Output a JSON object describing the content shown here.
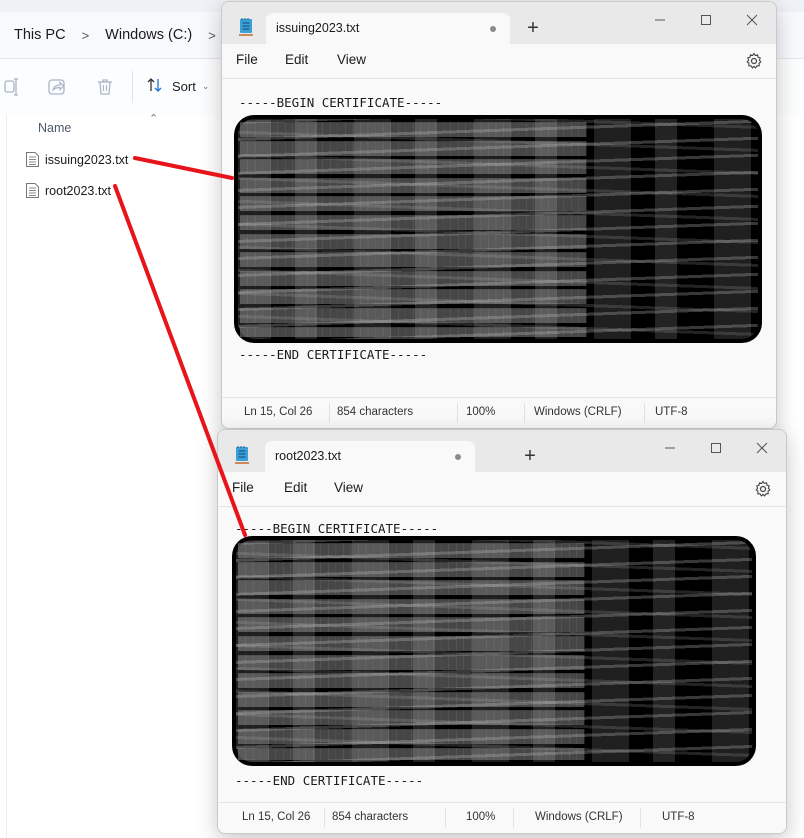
{
  "explorer": {
    "breadcrumb": [
      "This PC",
      "Windows (C:)"
    ],
    "breadcrumb_separator": ">",
    "toolbar": {
      "icons": [
        "rename-icon",
        "share-icon",
        "delete-icon"
      ],
      "sort_label": "Sort"
    },
    "list": {
      "column_header": "Name",
      "files": [
        {
          "name": "issuing2023.txt",
          "icon": "text-file-icon"
        },
        {
          "name": "root2023.txt",
          "icon": "text-file-icon"
        }
      ]
    }
  },
  "notepads": [
    {
      "tab_title": "issuing2023.txt",
      "unsaved_dot": true,
      "menu": [
        "File",
        "Edit",
        "View"
      ],
      "begin_line": "-----BEGIN CERTIFICATE-----",
      "end_line": "-----END CERTIFICATE-----",
      "body_redacted": true,
      "status": {
        "position": "Ln 15, Col 26",
        "characters": "854 characters",
        "zoom": "100%",
        "line_ending": "Windows (CRLF)",
        "encoding": "UTF-8"
      }
    },
    {
      "tab_title": "root2023.txt",
      "unsaved_dot": true,
      "menu": [
        "File",
        "Edit",
        "View"
      ],
      "begin_line": "-----BEGIN CERTIFICATE-----",
      "end_line": "-----END CERTIFICATE-----",
      "body_redacted": true,
      "status": {
        "position": "Ln 15, Col 26",
        "characters": "854 characters",
        "zoom": "100%",
        "line_ending": "Windows (CRLF)",
        "encoding": "UTF-8"
      }
    }
  ],
  "colors": {
    "annotation_arrow": "#e8141c",
    "notepad_icon": "#3ba0d8",
    "redaction": "#000000"
  }
}
